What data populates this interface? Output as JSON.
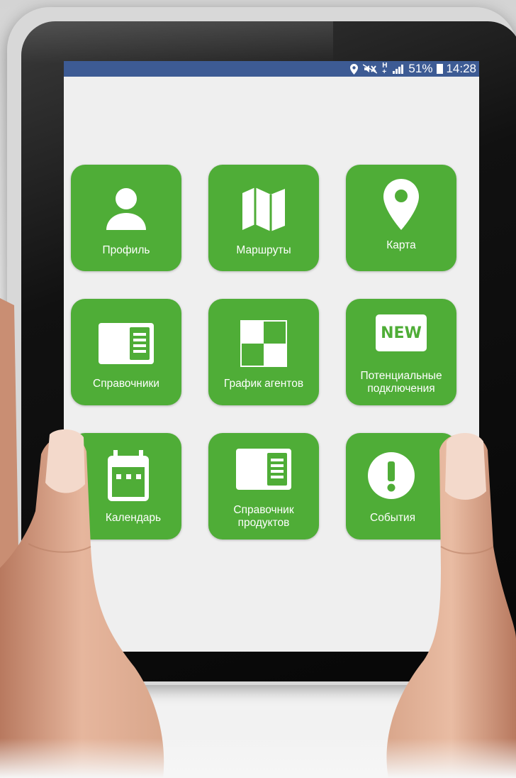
{
  "status_bar": {
    "battery": "51%",
    "time": "14:28",
    "icons": [
      "location-icon",
      "mute-icon",
      "hplus-icon",
      "signal-icon",
      "battery-icon"
    ],
    "background": "#3d5b94"
  },
  "colors": {
    "tile": "#4fad37",
    "screen_bg": "#efefef"
  },
  "tiles": [
    {
      "label": "Профиль",
      "icon": "person-icon"
    },
    {
      "label": "Маршруты",
      "icon": "map-icon"
    },
    {
      "label": "Карта",
      "icon": "location-pin-icon"
    },
    {
      "label": "Справочники",
      "icon": "book-icon"
    },
    {
      "label": "График агентов",
      "icon": "checker-icon"
    },
    {
      "label": "Потенциальные подключения",
      "icon": "new-badge-icon",
      "badge": "NEW"
    },
    {
      "label": "Календарь",
      "icon": "calendar-icon"
    },
    {
      "label": "Справочник продуктов",
      "icon": "book-icon"
    },
    {
      "label": "События",
      "icon": "alert-icon"
    }
  ]
}
